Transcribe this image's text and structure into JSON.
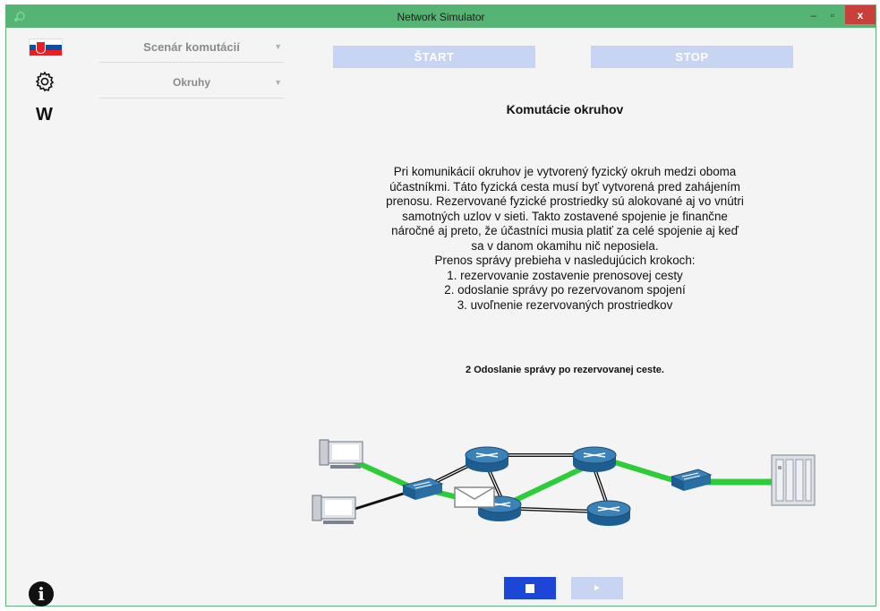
{
  "window": {
    "title": "Network Simulator",
    "controls": {
      "minimize": "–",
      "maximize": "▫",
      "close": "x"
    }
  },
  "sidebar": {
    "flag": "slovakia-flag-icon",
    "settings": "gear-icon",
    "wiki_label": "W",
    "info_label": "i"
  },
  "dropdowns": {
    "scenario": "Scenár komutácií",
    "type": "Okruhy"
  },
  "controls": {
    "start": "ŠTART",
    "stop": "STOP",
    "stop_symbol": "■",
    "play_symbol": "►"
  },
  "content": {
    "heading": "Komutácie okruhov",
    "paragraph_lines": [
      "Pri komunikácií okruhov je vytvorený fyzický okruh medzi oboma",
      "účastníkmi. Táto fyzická cesta musí byť vytvorená pred zahájením",
      "prenosu. Rezervované fyzické prostriedky sú alokované aj vo vnútri",
      "samotných uzlov v sieti. Takto zostavené spojenie je finančne",
      "náročné aj preto,  že účastníci musia platiť za celé spojenie aj keď",
      "sa v danom okamihu nič neposiela.",
      "Prenos správy prebieha v nasledujúcich krokoch:",
      "1. rezervovanie zostavenie prenosovej cesty",
      "2. odoslanie správy po rezervovanom spojení",
      "3. uvoľnenie rezervovaných prostriedkov"
    ],
    "step_caption": "2 Odoslanie správy po rezervovanej ceste."
  },
  "colors": {
    "titlebar": "#55b473",
    "active_link": "#2ecc3a",
    "inactive_link": "#111111",
    "primary_button": "#1b46d6",
    "disabled_button": "#c7d5f2",
    "close_button": "#c9403a"
  }
}
